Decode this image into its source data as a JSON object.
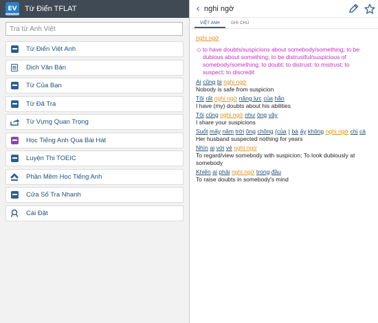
{
  "app": {
    "logo_text": "EV",
    "title": "Từ Điển TFLAT"
  },
  "search": {
    "placeholder": "Tra từ Anh Việt",
    "value": ""
  },
  "menu": [
    {
      "label": "Từ Điển Việt Anh",
      "icon": "dictionary-icon"
    },
    {
      "label": "Dịch Văn Bản",
      "icon": "document-icon"
    },
    {
      "label": "Từ Của Bạn",
      "icon": "book-icon"
    },
    {
      "label": "Từ Đã Tra",
      "icon": "history-book-icon"
    },
    {
      "label": "Từ Vựng Quan Trọng",
      "icon": "share-icon"
    },
    {
      "label": "Học Tiếng Anh Qua Bài Hát",
      "icon": "music-book-icon"
    },
    {
      "label": "Luyện Thi TOEIC",
      "icon": "toeic-icon"
    },
    {
      "label": "Phần Mềm Học Tiếng Anh",
      "icon": "apps-icon"
    },
    {
      "label": "Cửa Sổ Tra Nhanh",
      "icon": "quick-window-icon"
    },
    {
      "label": "Cài Đặt",
      "icon": "settings-icon"
    }
  ],
  "detail": {
    "word": "nghi ngờ",
    "tabs": [
      "VIỆT ANH",
      "GHI CHÚ"
    ],
    "active_tab": 0,
    "headword": "nghi ngờ",
    "sense": "◇ to have doubts/suspicions about somebody/something; to be dubious about something; to be distrustful/suspicious of somebody/something; to doubt; to distrust; to mistrust; to suspect; to discredit",
    "examples": [
      {
        "vi": [
          "Ai",
          "cũng",
          "bị",
          "nghi ngờ"
        ],
        "kw": [
          3
        ],
        "en": "Nobody is safe from suspicion"
      },
      {
        "vi": [
          "Tôi",
          "rất",
          "nghi ngờ",
          "năng lực",
          "của",
          "hắn"
        ],
        "kw": [
          2
        ],
        "en": "I have (my) doubts about his abilities"
      },
      {
        "vi": [
          "Tôi",
          "cũng",
          "nghi ngờ",
          "như",
          "ông",
          "vậy"
        ],
        "kw": [
          2
        ],
        "en": "I share your suspicions"
      },
      {
        "vi": [
          "Suốt",
          "mấy",
          "năm",
          "trời",
          "ông",
          "chồng",
          "(của",
          ")",
          "bà",
          "ấy",
          "không",
          "nghi ngờ",
          "chị",
          "cả"
        ],
        "kw": [
          11
        ],
        "en": "Her husband suspected nothing for years"
      },
      {
        "vi": [
          "Nhìn",
          "ai",
          "với",
          "vẻ",
          "nghi ngờ"
        ],
        "kw": [
          4
        ],
        "en": "To regard/view somebody with suspicion; To look dubiously at somebody"
      },
      {
        "vi": [
          "Khiến",
          "ai",
          "phải",
          "nghi ngờ",
          "trong",
          "đầu"
        ],
        "kw": [
          3
        ],
        "en": "To raise doubts in somebody's mind"
      }
    ]
  },
  "colors": {
    "header_dark": "#3f4a55",
    "accent_blue": "#2c5f8f",
    "keyword_orange": "#e08f1a",
    "sense_magenta": "#c02fc0"
  }
}
